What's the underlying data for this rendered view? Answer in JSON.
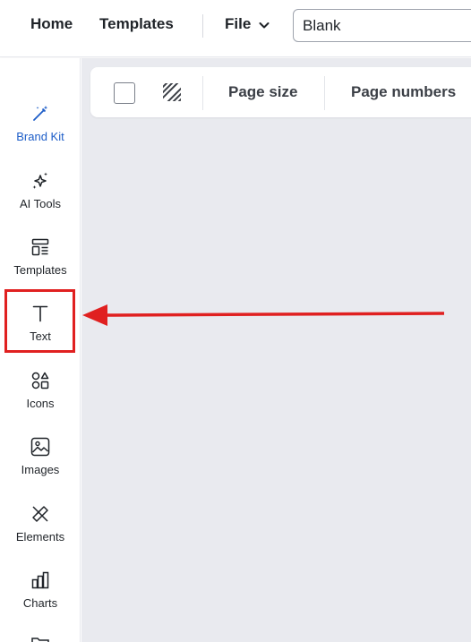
{
  "header": {
    "home_label": "Home",
    "templates_label": "Templates",
    "file_label": "File",
    "document_name": "Blank"
  },
  "sidebar": {
    "items": [
      {
        "label": "Brand Kit",
        "icon": "magic-wand-icon",
        "active": true
      },
      {
        "label": "AI Tools",
        "icon": "sparkles-icon"
      },
      {
        "label": "Templates",
        "icon": "templates-icon"
      },
      {
        "label": "Text",
        "icon": "text-icon"
      },
      {
        "label": "Icons",
        "icon": "shapes-icon"
      },
      {
        "label": "Images",
        "icon": "image-icon"
      },
      {
        "label": "Elements",
        "icon": "elements-icon"
      },
      {
        "label": "Charts",
        "icon": "bar-chart-icon"
      }
    ]
  },
  "toolbar": {
    "page_size_label": "Page size",
    "page_numbers_label": "Page numbers"
  },
  "annotation": {
    "highlight_color": "#e02020",
    "target": "Text"
  },
  "colors": {
    "accent": "#1e5ec8",
    "canvas_bg": "#e9eaef",
    "annotation_red": "#e02020"
  }
}
